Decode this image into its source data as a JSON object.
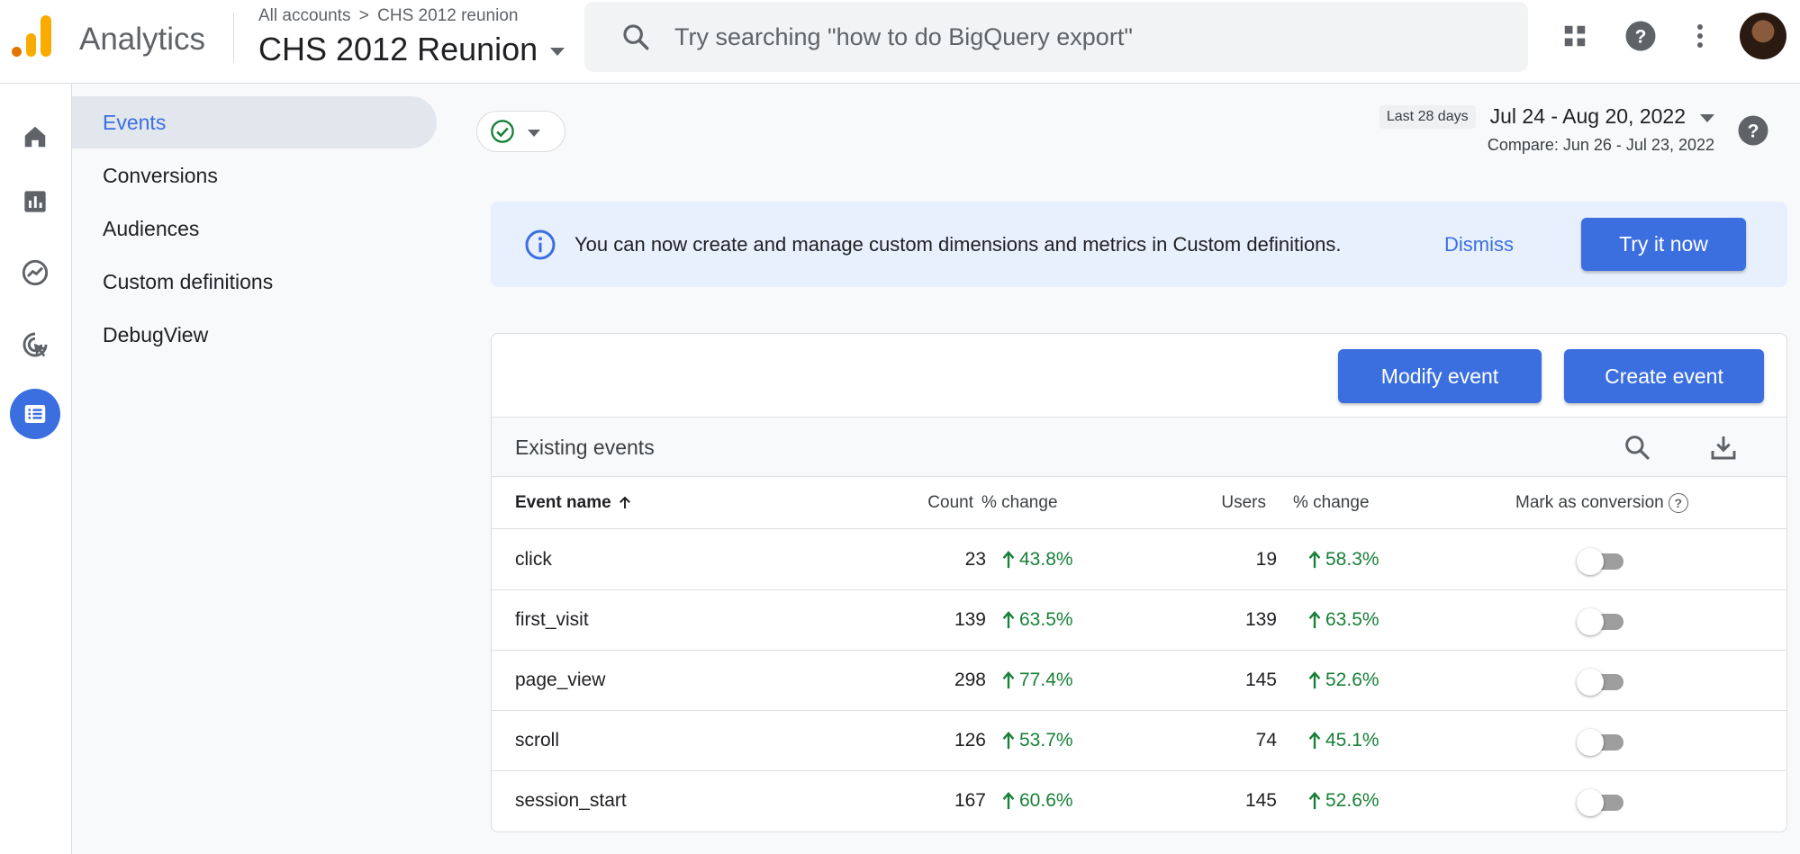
{
  "header": {
    "app_name": "Analytics",
    "breadcrumb_account": "All accounts",
    "breadcrumb_separator": ">",
    "breadcrumb_property": "CHS 2012 reunion",
    "property_name": "CHS 2012 Reunion",
    "search_placeholder": "Try searching \"how to do BigQuery export\""
  },
  "rail": {
    "items": [
      "home-icon",
      "reports-icon",
      "explore-icon",
      "advertising-icon",
      "configure-icon"
    ],
    "active": "configure-icon"
  },
  "subnav": {
    "items": [
      {
        "label": "Events",
        "active": true
      },
      {
        "label": "Conversions",
        "active": false
      },
      {
        "label": "Audiences",
        "active": false
      },
      {
        "label": "Custom definitions",
        "active": false
      },
      {
        "label": "DebugView",
        "active": false
      }
    ]
  },
  "date": {
    "badge": "Last 28 days",
    "range": "Jul 24 - Aug 20, 2022",
    "compare": "Compare: Jun 26 - Jul 23, 2022"
  },
  "banner": {
    "text": "You can now create and manage custom dimensions and metrics in Custom definitions.",
    "dismiss_label": "Dismiss",
    "try_label": "Try it now"
  },
  "card": {
    "modify_label": "Modify event",
    "create_label": "Create event",
    "title": "Existing events"
  },
  "table": {
    "columns": {
      "name": "Event name",
      "count": "Count",
      "count_change": "% change",
      "users": "Users",
      "users_change": "% change",
      "mark": "Mark as conversion"
    },
    "rows": [
      {
        "name": "click",
        "count": "23",
        "count_change": "43.8%",
        "users": "19",
        "users_change": "58.3%",
        "conversion": false
      },
      {
        "name": "first_visit",
        "count": "139",
        "count_change": "63.5%",
        "users": "139",
        "users_change": "63.5%",
        "conversion": false
      },
      {
        "name": "page_view",
        "count": "298",
        "count_change": "77.4%",
        "users": "145",
        "users_change": "52.6%",
        "conversion": false
      },
      {
        "name": "scroll",
        "count": "126",
        "count_change": "53.7%",
        "users": "74",
        "users_change": "45.1%",
        "conversion": false
      },
      {
        "name": "session_start",
        "count": "167",
        "count_change": "60.6%",
        "users": "145",
        "users_change": "52.6%",
        "conversion": false
      }
    ]
  },
  "colors": {
    "accent": "#3b6fe0",
    "positive": "#188038",
    "logo": "#f9ab00"
  }
}
